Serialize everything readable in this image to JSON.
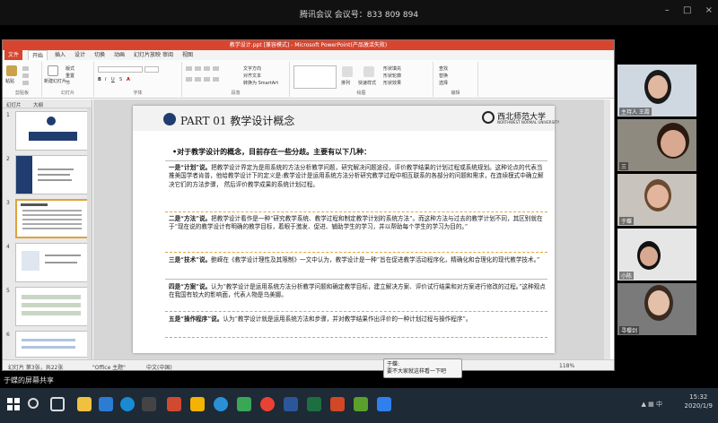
{
  "meeting": {
    "title": "腾讯会议 会议号：833 809 894",
    "controls": [
      "–",
      "□",
      "×"
    ]
  },
  "ppt": {
    "window_title": "教学设计.ppt [兼容模式] - Microsoft PowerPoint(产品激活失败)",
    "tabs": [
      "文件",
      "开始",
      "插入",
      "设计",
      "切换",
      "动画",
      "幻灯片放映",
      "审阅",
      "视图"
    ],
    "ribbon_groups": [
      "剪贴板",
      "幻灯片",
      "字体",
      "段落",
      "绘图",
      "编辑"
    ],
    "ribbon_buttons": {
      "paste": "粘贴",
      "new_slide": "新建幻灯片",
      "layout": "版式",
      "reset": "重置",
      "section": "节",
      "text_direction": "文字方向",
      "align_text": "对齐文本",
      "smartart": "转换为 SmartArt",
      "arrange": "排列",
      "quick_styles": "快速样式",
      "shape_fill": "形状填充",
      "shape_outline": "形状轮廓",
      "shape_effects": "形状效果",
      "find": "查找",
      "replace": "替换",
      "select": "选择"
    },
    "pane_tabs": [
      "幻灯片",
      "大纲"
    ],
    "slide_numbers": [
      "1",
      "2",
      "3",
      "4",
      "5",
      "6"
    ],
    "status": {
      "slide": "幻灯片 第3张，共22张",
      "theme": "\"Office 主题\"",
      "lang": "中文(中国)",
      "zoom": "118%"
    }
  },
  "slide": {
    "title": "PART 01 教学设计概念",
    "university": "西北师范大学",
    "university_en": "NORTHWEST NORMAL UNIVERSITY",
    "intro": "•对于教学设计的概念，目前存在一些分歧。主要有以下几种：",
    "paragraphs": [
      {
        "lead": "一是“计划”说。",
        "text": "把教学设计界定为是用系统的方法分析教学问题，研究解决问题途径，评价教学结果的计划过程或系统规划。这种论点的代表当推美国学者肯普，他给教学设计下的定义是:教学设计是运用系统方法分析研究教学过程中相互联系的各部分的问题和需求，在连续模式中确立解决它们的方法步骤， 然后评价教学成果的系统计划过程。"
      },
      {
        "lead": "二是“方法”说。",
        "text": "把教学设计看作是一种“研究教学系统、教学过程和制定教学计划的系统方法”。而这种方法与过去的教学计划不同，其区别就在于“现在说的教学设计有明确的教学目标，着眼于激发、促进、辅助学生的学习，并以帮助每个学生的学习为目的。”"
      },
      {
        "lead": "三是“技术”说。",
        "text": "鲍嵘在《教学设计理性及其限制》一文中认为，教学设计是一种“旨在促进教学活动程序化，精确化和合理化的现代教学技术。”"
      },
      {
        "lead": "四是“方案”说。",
        "text": "认为“教学设计是运用系统方法分析教学问题和确定教学目标，建立解决方案、评价试行结果和对方案进行修改的过程。”这种观点在我国有较大的影响面，代表人物是乌美娜。"
      },
      {
        "lead": "五是“操作程序”说。",
        "text": "认为“教学设计就是运用系统方法和步骤，并对教学结果作出评价的一种计划过程与操作程序”。"
      }
    ]
  },
  "participants": [
    {
      "name": "主持人  王霞",
      "color": "#cfd8e0",
      "face": "#e0b8a0",
      "hair": "#1a1a1a"
    },
    {
      "name": "三",
      "color": "#8f8a80",
      "face": "#d9a890",
      "hair": "#2a1a10"
    },
    {
      "name": "于蝶",
      "color": "#c9c3bd",
      "face": "#e2b59c",
      "hair": "#6a4a30"
    },
    {
      "name": "小陈",
      "color": "#e6e6e6",
      "face": "#d8a890",
      "hair": "#111"
    },
    {
      "name": "寻樱剑",
      "color": "#7a7a7a",
      "face": "#e4c0a8",
      "hair": "#3a2a20"
    }
  ],
  "share_label": "于蝶的屏幕共享",
  "chat": {
    "sender": "于蝶:",
    "message": "要不大家就这样看一下吧"
  },
  "taskbar": {
    "time": "15:32",
    "date": "2020/1/9",
    "ime": "中",
    "icons": [
      "windows-icon",
      "search-icon",
      "task-view-icon",
      "explorer-icon",
      "store-icon",
      "edge-icon",
      "media-icon",
      "chrome-icon",
      "ppt-icon",
      "word-icon",
      "meeting-icon"
    ]
  }
}
